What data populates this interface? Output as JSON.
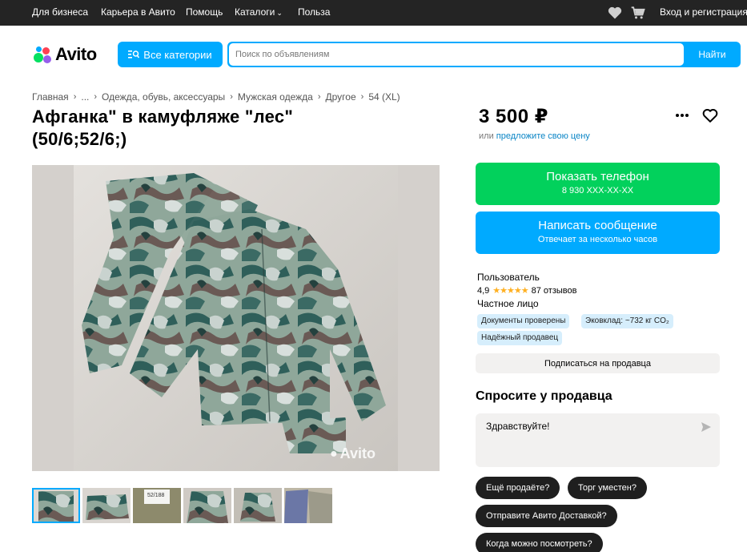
{
  "topbar": {
    "links": [
      "Для бизнеса",
      "Карьера в Авито",
      "Помощь",
      "Каталоги",
      "Польза"
    ],
    "login": "Вход и регистрация"
  },
  "header": {
    "logo": "Avito",
    "categories_button": "Все категории",
    "search_placeholder": "Поиск по объявлениям",
    "search_button": "Найти"
  },
  "breadcrumbs": [
    "Главная",
    "...",
    "Одежда, обувь, аксессуары",
    "Мужская одежда",
    "Другое",
    "54 (XL)"
  ],
  "listing": {
    "title": "Афганка\" в камуфляже \"лес\" (50/6;52/6;)",
    "price": "3 500 ₽",
    "price_prefix": "или",
    "price_link": "предложите свою цену",
    "watermark": "Avito"
  },
  "actions": {
    "phone_main": "Показать телефон",
    "phone_sub": "8 930 XXX-XX-XX",
    "message_main": "Написать сообщение",
    "message_sub": "Отвечает за несколько часов"
  },
  "seller": {
    "name": "Пользователь",
    "rating": "4,9",
    "stars": "★★★★★",
    "reviews": "87 отзывов",
    "type": "Частное лицо",
    "badges": [
      "Документы проверены",
      "Эковклад: ~732 кг CO₂",
      "Надёжный продавец"
    ],
    "subscribe": "Подписаться на продавца"
  },
  "ask": {
    "title": "Спросите у продавца",
    "message": "Здравствуйте!",
    "chips": [
      "Ещё продаёте?",
      "Торг уместен?",
      "Отправите Авито Доставкой?",
      "Когда можно посмотреть?"
    ]
  },
  "thumbnail_labels": [
    "52/188"
  ],
  "colors": {
    "accent": "#00aaff",
    "green": "#02d15c",
    "topbar": "#242424"
  }
}
